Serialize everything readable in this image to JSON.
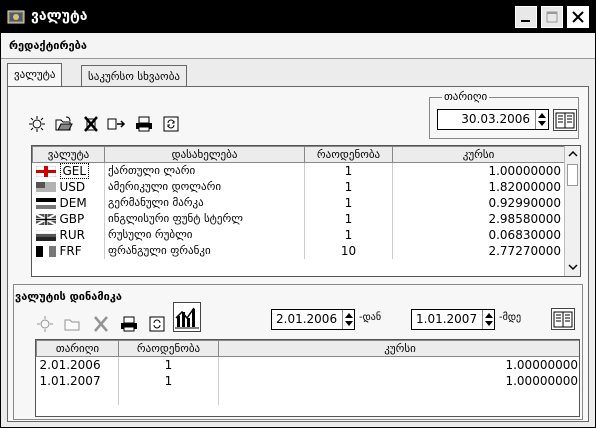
{
  "window": {
    "title": "ვალუტა"
  },
  "menu": {
    "items": [
      "რედაქტირება"
    ]
  },
  "tabs": [
    {
      "label": "ვალუტა",
      "active": true
    },
    {
      "label": "საკურსო სხვაობა",
      "active": false
    }
  ],
  "toolbar": {
    "icons": [
      "new-icon",
      "open-folder-icon",
      "delete-icon",
      "export-icon",
      "print-icon",
      "refresh-icon"
    ]
  },
  "date_filter": {
    "label": "თარიღი",
    "value": "30.03.2006"
  },
  "currency_table": {
    "columns": [
      "ვალუტა",
      "დასახელება",
      "რაოდენობა",
      "კურსი"
    ],
    "rows": [
      {
        "code": "GEL",
        "flag": "flag-georgia",
        "name": "ქართული ლარი",
        "qty": "1",
        "rate": "1.00000000",
        "selected": true
      },
      {
        "code": "USD",
        "flag": "flag-usa",
        "name": "ამერიკული დოლარი",
        "qty": "1",
        "rate": "1.82000000"
      },
      {
        "code": "DEM",
        "flag": "flag-germany",
        "name": "გერმანული მარკა",
        "qty": "1",
        "rate": "0.92990000"
      },
      {
        "code": "GBP",
        "flag": "flag-uk",
        "name": "ინგლისური ფუნტ სტერლ",
        "qty": "1",
        "rate": "2.98580000"
      },
      {
        "code": "RUR",
        "flag": "flag-russia",
        "name": "რუსული რუბლი",
        "qty": "1",
        "rate": "0.06830000"
      },
      {
        "code": "FRF",
        "flag": "flag-france",
        "name": "ფრანგული ფრანკი",
        "qty": "10",
        "rate": "2.77270000"
      }
    ]
  },
  "history": {
    "title": "ვალუტის დინამიკა",
    "from_date": "2.01.2006",
    "from_suffix": "-დან",
    "to_date": "1.01.2007",
    "to_suffix": "-მდე",
    "columns": [
      "თარიღი",
      "რაოდენობა",
      "კურსი"
    ],
    "rows": [
      {
        "date": "2.01.2006",
        "qty": "1",
        "rate": "1.00000000"
      },
      {
        "date": "1.01.2007",
        "qty": "1",
        "rate": "1.00000000"
      }
    ]
  }
}
